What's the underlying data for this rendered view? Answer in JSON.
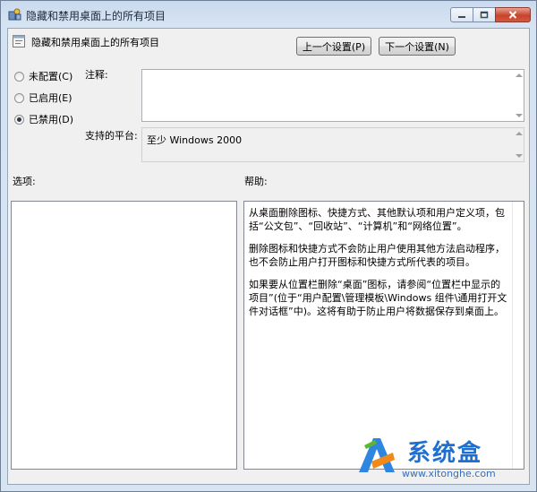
{
  "window": {
    "title": "隐藏和禁用桌面上的所有项目",
    "caption_buttons": [
      "minimize",
      "maximize",
      "close"
    ]
  },
  "header": {
    "policy_name": "隐藏和禁用桌面上的所有项目",
    "prev_button": "上一个设置(P)",
    "next_button": "下一个设置(N)"
  },
  "state": {
    "options": [
      {
        "label": "未配置(C)",
        "checked": false
      },
      {
        "label": "已启用(E)",
        "checked": false
      },
      {
        "label": "已禁用(D)",
        "checked": true
      }
    ]
  },
  "comment": {
    "label": "注释:",
    "value": ""
  },
  "supported": {
    "label": "支持的平台:",
    "value": "至少 Windows 2000"
  },
  "options_panel": {
    "label": "选项:"
  },
  "help_panel": {
    "label": "帮助:",
    "paragraphs": [
      "从桌面删除图标、快捷方式、其他默认项和用户定义项，包括“公文包”、“回收站”、“计算机”和“网络位置”。",
      "删除图标和快捷方式不会防止用户使用其他方法启动程序，也不会防止用户打开图标和快捷方式所代表的项目。",
      "如果要从位置栏删除“桌面”图标，请参阅“位置栏中显示的项目”(位于“用户配置\\管理模板\\Windows 组件\\通用打开文件对话框”中)。这将有助于防止用户将数据保存到桌面上。"
    ]
  },
  "watermark": {
    "title": "系统盒",
    "url": "www.xitonghe.com"
  },
  "colors": {
    "title_bar": "#c9daee",
    "client_bg": "#f0f0f0",
    "close_button": "#c8442c",
    "watermark_blue": "#1f6fd0"
  }
}
